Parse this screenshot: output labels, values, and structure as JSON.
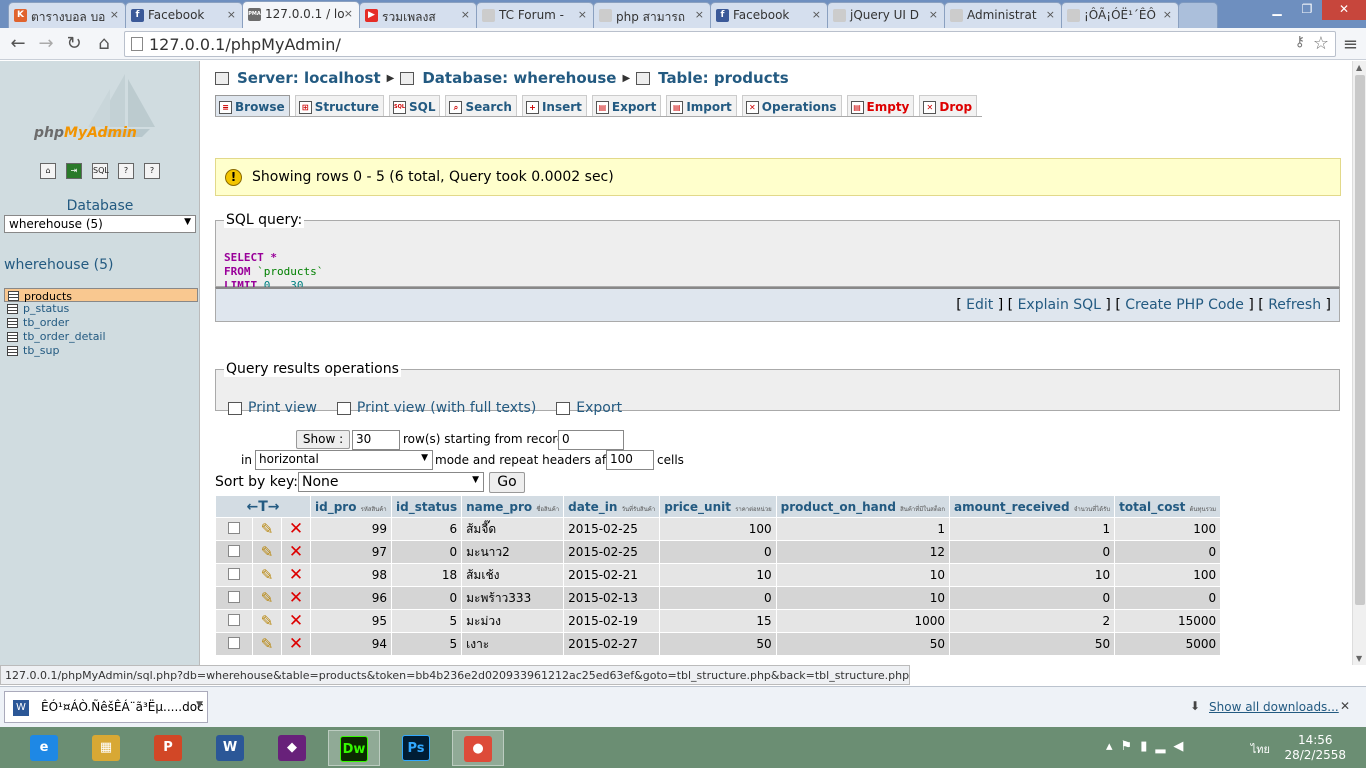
{
  "browser": {
    "tabs": [
      {
        "icon": "K",
        "icon_color": "#e0632e",
        "label": "ตารางบอล บอ"
      },
      {
        "icon": "f",
        "icon_color": "#3b5998",
        "label": "Facebook"
      },
      {
        "icon": "PMA",
        "icon_color": "#6c6c6c",
        "label": "127.0.0.1 / lo",
        "active": true
      },
      {
        "icon": "▶",
        "icon_color": "#e52d27",
        "label": "รวมเพลงส"
      },
      {
        "icon": "",
        "icon_color": "#cccccc",
        "label": "TC Forum -"
      },
      {
        "icon": "",
        "icon_color": "#cccccc",
        "label": "php สามารถ"
      },
      {
        "icon": "f",
        "icon_color": "#3b5998",
        "label": "Facebook"
      },
      {
        "icon": "",
        "icon_color": "#cccccc",
        "label": "jQuery UI D"
      },
      {
        "icon": "",
        "icon_color": "#cccccc",
        "label": "Administrat"
      },
      {
        "icon": "",
        "icon_color": "#cccccc",
        "label": "¡ÔÃ¡ÓË¹´ÊÔ"
      }
    ],
    "url": "127.0.0.1/phpMyAdmin/",
    "status_url": "127.0.0.1/phpMyAdmin/sql.php?db=wherehouse&table=products&token=bb4b236e2d020933961212ac25ed63ef&goto=tbl_structure.php&back=tbl_structure.php&pos=0"
  },
  "sidebar": {
    "logo_text_a": "php",
    "logo_text_b": "MyAdmin",
    "database_label": "Database",
    "database_select": "wherehouse (5)",
    "db_title": "wherehouse (5)",
    "tables": [
      "products",
      "p_status",
      "tb_order",
      "tb_order_detail",
      "tb_sup"
    ]
  },
  "breadcrumb": {
    "server": "Server: localhost",
    "database": "Database: wherehouse",
    "table": "Table: products"
  },
  "tabs": [
    {
      "label": "Browse",
      "icon": "≡"
    },
    {
      "label": "Structure",
      "icon": "⊞"
    },
    {
      "label": "SQL",
      "icon": "SQL"
    },
    {
      "label": "Search",
      "icon": "⌕"
    },
    {
      "label": "Insert",
      "icon": "+"
    },
    {
      "label": "Export",
      "icon": "▤"
    },
    {
      "label": "Import",
      "icon": "▤"
    },
    {
      "label": "Operations",
      "icon": "✕"
    },
    {
      "label": "Empty",
      "icon": "▤"
    },
    {
      "label": "Drop",
      "icon": "✕"
    }
  ],
  "notice": "Showing rows 0 - 5 (6 total, Query took 0.0002 sec)",
  "sql": {
    "legend": "SQL query:",
    "kw_select": "SELECT",
    "star": " *",
    "kw_from": "FROM",
    "table": " `products`",
    "kw_limit": "LIMIT",
    "limit_a": " 0",
    "limit_sep": " , ",
    "limit_b": "30",
    "links": [
      "Edit",
      "Explain SQL",
      "Create PHP Code",
      "Refresh"
    ]
  },
  "ops": {
    "legend": "Query results operations",
    "links": [
      "Print view",
      "Print view (with full texts)",
      "Export"
    ]
  },
  "nav": {
    "show_button": "Show :",
    "rows_value": "30",
    "rows_text": "row(s) starting from record #",
    "start_value": "0",
    "in_text": "in",
    "mode_select": "horizontal",
    "mode_text": "mode and repeat headers after",
    "repeat_value": "100",
    "cells_text": "cells",
    "sort_label": "Sort by key:",
    "sort_select": "None",
    "go_button": "Go"
  },
  "table": {
    "columns": [
      {
        "name": "id_pro",
        "sub": "รหัสสินค้า"
      },
      {
        "name": "id_status",
        "sub": ""
      },
      {
        "name": "name_pro",
        "sub": "ชื่อสินค้า"
      },
      {
        "name": "date_in",
        "sub": "วันที่รับสินค้า"
      },
      {
        "name": "price_unit",
        "sub": "ราคาต่อหน่วย"
      },
      {
        "name": "product_on_hand",
        "sub": "สินค้าที่มีในสต็อก"
      },
      {
        "name": "amount_received",
        "sub": "จำนวนที่ได้รับ"
      },
      {
        "name": "total_cost",
        "sub": "ต้นทุนรวม"
      }
    ],
    "rows": [
      [
        "99",
        "6",
        "ส้มจี๊ด",
        "2015-02-25",
        "100",
        "1",
        "1",
        "100"
      ],
      [
        "97",
        "0",
        "มะนาว2",
        "2015-02-25",
        "0",
        "12",
        "0",
        "0"
      ],
      [
        "98",
        "18",
        "ส้มเช้ง",
        "2015-02-21",
        "10",
        "10",
        "10",
        "100"
      ],
      [
        "96",
        "0",
        "มะพร้าว333",
        "2015-02-13",
        "0",
        "10",
        "0",
        "0"
      ],
      [
        "95",
        "5",
        "มะม่วง",
        "2015-02-19",
        "15",
        "1000",
        "2",
        "15000"
      ],
      [
        "94",
        "5",
        "เงาะ",
        "2015-02-27",
        "50",
        "50",
        "50",
        "5000"
      ]
    ]
  },
  "downloads": {
    "item": "ÊÓ¹¤ÁÒ.ÑêšÊÁ¨ã³Ëµ.....doc",
    "show_all": "Show all downloads..."
  },
  "taskbar": {
    "apps": [
      {
        "label": "e",
        "color": "#1e88e5"
      },
      {
        "label": "▦",
        "color": "#d8a834"
      },
      {
        "label": "P",
        "color": "#d24726"
      },
      {
        "label": "W",
        "color": "#2b5797"
      },
      {
        "label": "◆",
        "color": "#68217a"
      },
      {
        "label": "Dw",
        "color": "#35fa00"
      },
      {
        "label": "Ps",
        "color": "#001d34"
      },
      {
        "label": "●",
        "color": "#dd4b39"
      }
    ],
    "lang": "ไทย",
    "time": "14:56",
    "date": "28/2/2558"
  }
}
